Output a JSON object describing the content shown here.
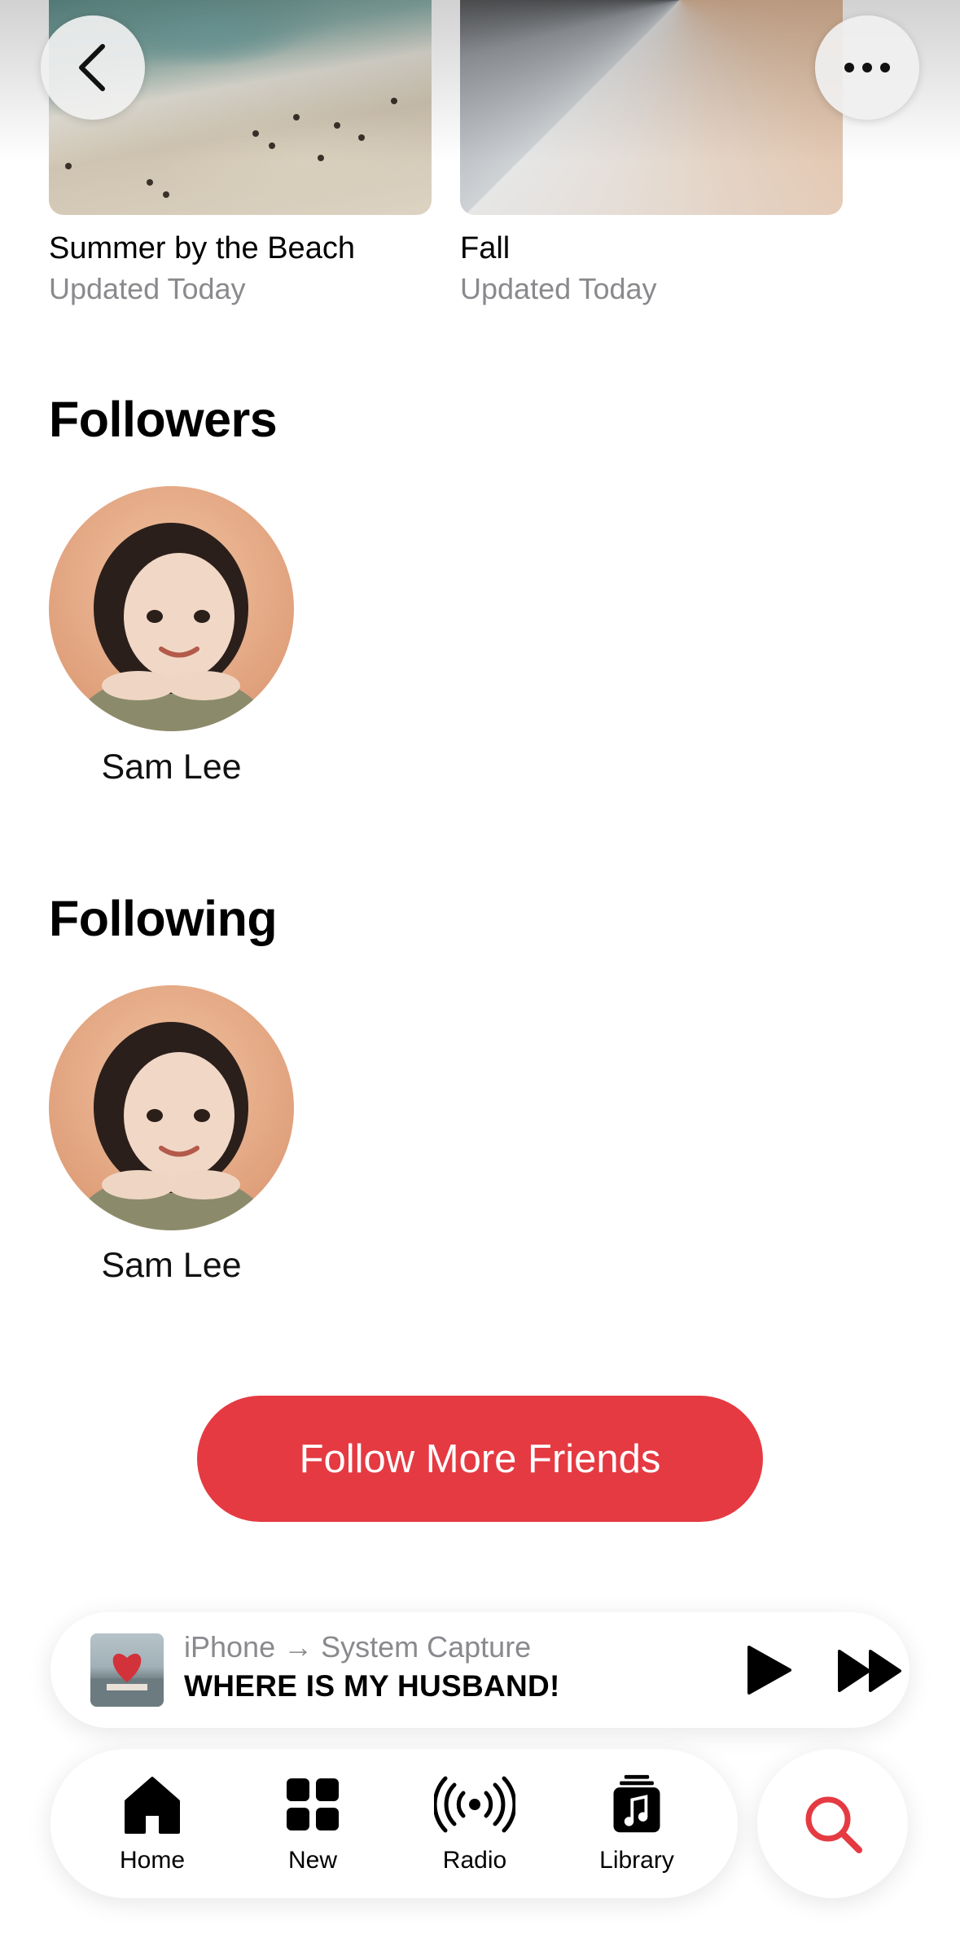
{
  "playlists": [
    {
      "title": "Summer by the Beach",
      "subtitle": "Updated Today"
    },
    {
      "title": "Fall",
      "subtitle": "Updated Today"
    }
  ],
  "followers": {
    "title": "Followers",
    "people": [
      {
        "name": "Sam Lee"
      }
    ]
  },
  "following": {
    "title": "Following",
    "people": [
      {
        "name": "Sam Lee"
      }
    ]
  },
  "follow_button": {
    "label": "Follow More Friends"
  },
  "mini_player": {
    "route": "iPhone → System Capture",
    "song": "WHERE IS MY HUSBAND!"
  },
  "tabs": [
    {
      "label": "Home",
      "icon": "home-icon"
    },
    {
      "label": "New",
      "icon": "grid-icon"
    },
    {
      "label": "Radio",
      "icon": "radio-icon"
    },
    {
      "label": "Library",
      "icon": "library-icon"
    }
  ],
  "colors": {
    "accent": "#e53a42",
    "secondary_text": "#8a8a8e"
  }
}
